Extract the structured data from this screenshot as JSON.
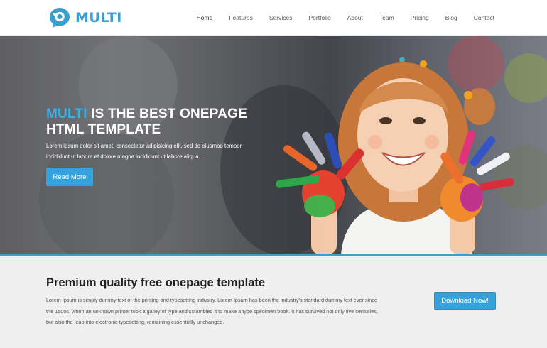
{
  "header": {
    "logo_text": "MULTI",
    "logo_icon": "chat-bubble-logo-icon",
    "nav": [
      {
        "label": "Home",
        "active": true
      },
      {
        "label": "Features"
      },
      {
        "label": "Services"
      },
      {
        "label": "Portfolio"
      },
      {
        "label": "About"
      },
      {
        "label": "Team"
      },
      {
        "label": "Pricing"
      },
      {
        "label": "Blog"
      },
      {
        "label": "Contact"
      }
    ]
  },
  "hero": {
    "title_brand": "MULTI",
    "title_rest_line1": " IS THE BEST ONEPAGE",
    "title_line2": "HTML TEMPLATE",
    "description": "Lorem ipsum dolor sit amet, consectetur adipisicing elit, sed do eiusmod tempor incididunt ut labore et dolore magna incididunt ut labore aliqua.",
    "button_label": "Read More",
    "image_subject": "smiling girl with paint-covered hands"
  },
  "promo": {
    "title": "Premium quality free onepage template",
    "text": "Lorem Ipsum is simply dummy text of the printing and typesetting industry. Lorem Ipsum has been the industry's standard dummy text ever since the 1500s, when an unknown printer took a galley of type and scrambled it to make a type specimen book. It has survived not only five centuries, but also the leap into electronic typesetting, remaining essentially unchanged.",
    "button_label": "Download Now!"
  },
  "colors": {
    "accent": "#36a2dc",
    "brand": "#3a9fcf",
    "promo_bg": "#efefef"
  }
}
